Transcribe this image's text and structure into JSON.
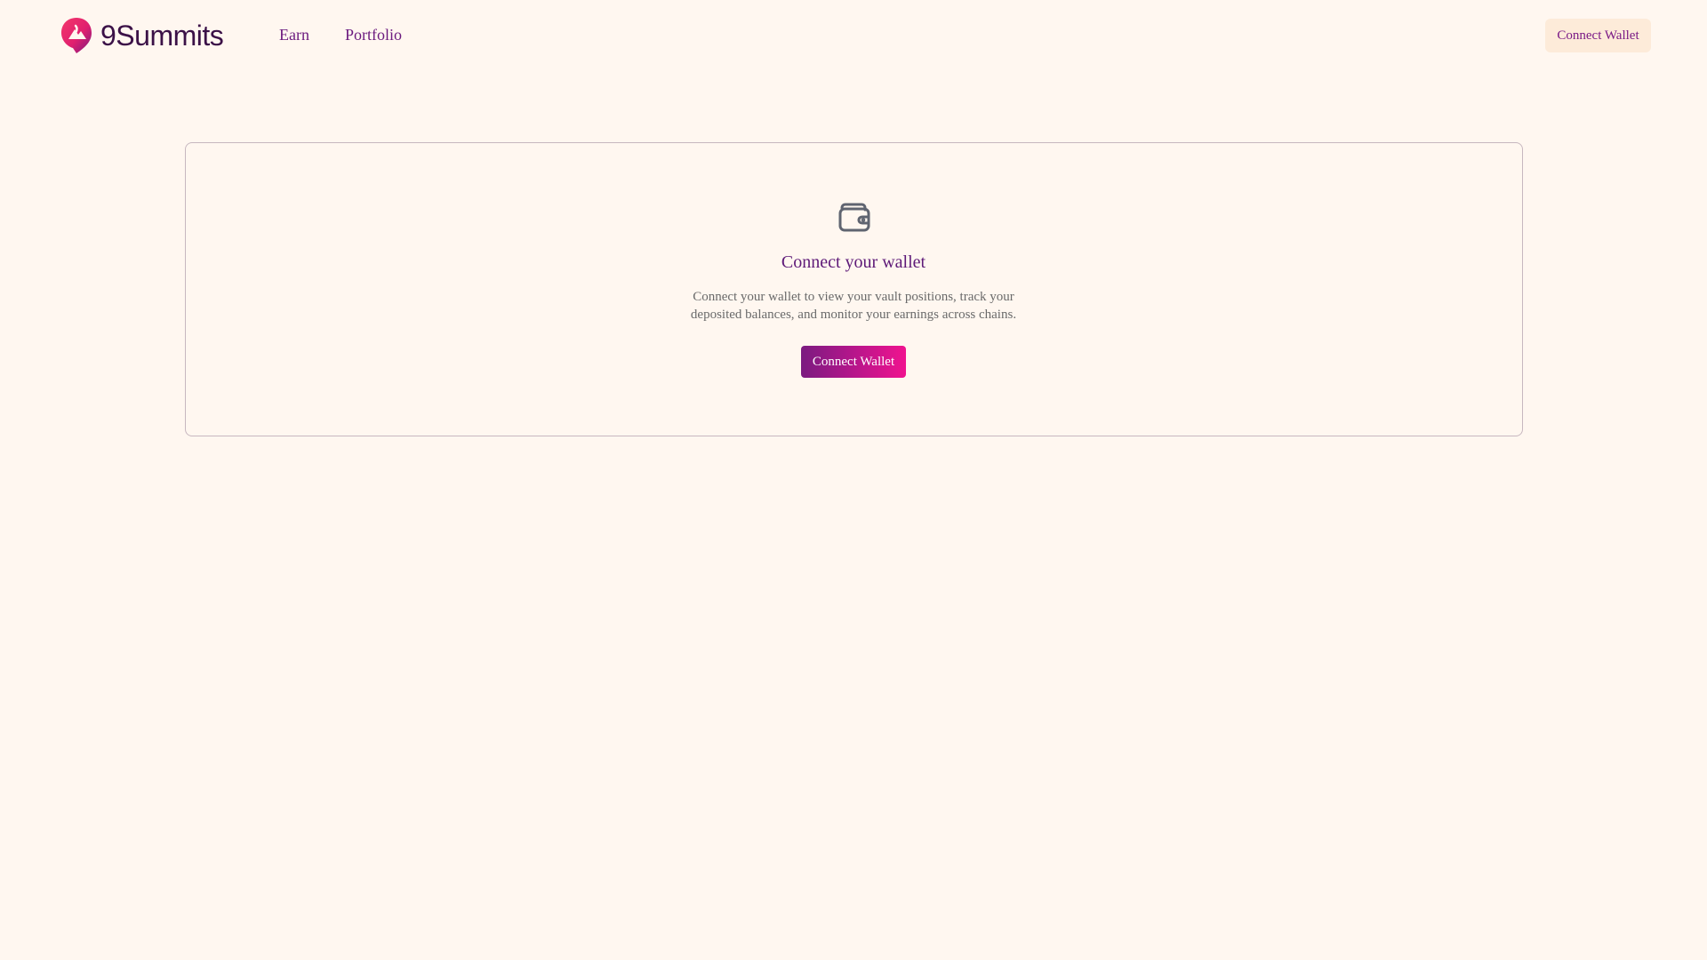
{
  "brand": {
    "name": "9Summits"
  },
  "nav": {
    "items": [
      {
        "label": "Earn"
      },
      {
        "label": "Portfolio"
      }
    ]
  },
  "header": {
    "connect_label": "Connect Wallet"
  },
  "empty_state": {
    "icon": "wallet-icon",
    "title": "Connect your wallet",
    "description": "Connect your wallet to view your vault positions, track your deposited balances, and monitor your earnings across chains.",
    "button_label": "Connect Wallet"
  },
  "colors": {
    "background": "#fff7f0",
    "brand_dark": "#3b1147",
    "accent": "#6b1a7e",
    "gradient_start": "#7b1b80",
    "gradient_end": "#f0138f"
  }
}
